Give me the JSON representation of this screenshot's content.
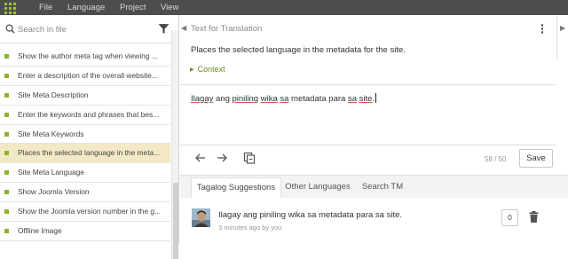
{
  "menu": {
    "items": [
      "File",
      "Language",
      "Project",
      "View"
    ]
  },
  "sidebar": {
    "search_placeholder": "Search in file",
    "items": [
      {
        "label": "Show the author meta tag when viewing ..."
      },
      {
        "label": "Enter a description of the overall website..."
      },
      {
        "label": "Site Meta Description"
      },
      {
        "label": "Enter the keywords and phrases that bes..."
      },
      {
        "label": "Site Meta Keywords"
      },
      {
        "label": "Places the selected language in the meta..."
      },
      {
        "label": "Site Meta Language"
      },
      {
        "label": "Show Joomla Version"
      },
      {
        "label": "Show the Joomla version number in the g..."
      },
      {
        "label": "Offline Image"
      }
    ],
    "selected_index": 5
  },
  "editor": {
    "source_label": "Text for Translation",
    "source_text": "Places the selected language in the metadata for the site.",
    "context_label": "Context",
    "translation_words": [
      "Ilagay",
      " ",
      "ang",
      " ",
      "piniling",
      " ",
      "wika",
      " ",
      "sa",
      " metadata para ",
      "sa",
      " ",
      "site",
      "."
    ],
    "char_count": "58 / 50",
    "save_label": "Save"
  },
  "tabs": [
    {
      "label": "Tagalog Suggestions",
      "active": true
    },
    {
      "label": "Other Languages",
      "active": false
    },
    {
      "label": "Search TM",
      "active": false
    }
  ],
  "suggestion": {
    "text": "Ilagay ang piniling wika sa metadata para sa site.",
    "meta": "3 minutes ago by you",
    "votes": "0"
  },
  "colors": {
    "topbar": "#4d4d4d",
    "accent_green": "#8ab52a",
    "selected_row": "#f4e9c6"
  }
}
